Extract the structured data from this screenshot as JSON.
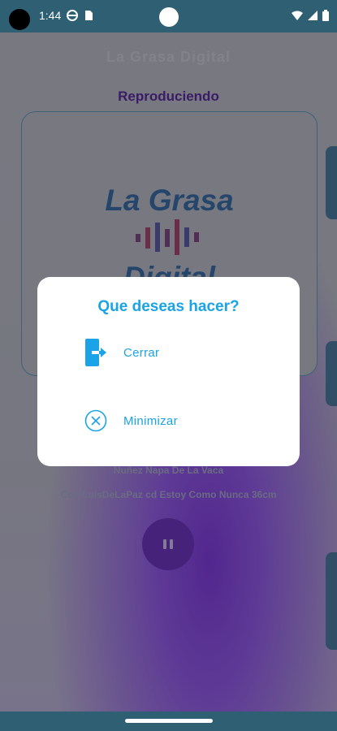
{
  "status_bar": {
    "time": "1:44"
  },
  "app": {
    "title": "La Grasa Digital",
    "now_playing_label": "Reproduciendo",
    "logo_line1": "La Grasa",
    "logo_line2": "Digital",
    "artist": "Nuñez Napa De La Vaca",
    "song": "Con LuisDeLaPaz cd Estoy Como Nunca 36cm"
  },
  "dialog": {
    "title": "Que deseas hacer?",
    "options": [
      {
        "label": "Cerrar",
        "icon": "exit-door-icon"
      },
      {
        "label": "Minimizar",
        "icon": "close-circle-icon"
      }
    ]
  },
  "colors": {
    "accent": "#1aa3e6",
    "system_bar": "#2e5f73",
    "play_button": "#4b1a8c"
  }
}
